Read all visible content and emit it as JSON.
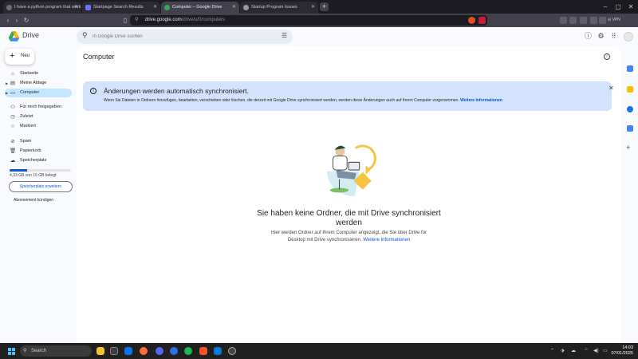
{
  "browser": {
    "tabs": [
      {
        "title": "I have a python program that work",
        "active": false
      },
      {
        "title": "Startpage Search Results",
        "active": false
      },
      {
        "title": "Computer – Google Drive",
        "active": true
      },
      {
        "title": "Startup Program Issues",
        "active": false
      }
    ],
    "url_host": "drive.google.com",
    "url_path": "/drive/u/0/computers",
    "vpn_label": "VPN"
  },
  "drive": {
    "app_name": "Drive",
    "search_placeholder": "In Google Drive suchen",
    "new_button": "Neu",
    "nav": [
      {
        "label": "Startseite",
        "icon": "home-icon"
      },
      {
        "label": "Meine Ablage",
        "icon": "my-drive-icon"
      },
      {
        "label": "Computer",
        "icon": "computer-icon",
        "active": true
      },
      {
        "label": "Für mich freigegeben",
        "icon": "shared-icon"
      },
      {
        "label": "Zuletzt",
        "icon": "clock-icon"
      },
      {
        "label": "Markiert",
        "icon": "star-icon"
      },
      {
        "label": "Spam",
        "icon": "spam-icon"
      },
      {
        "label": "Papierkorb",
        "icon": "trash-icon"
      },
      {
        "label": "Speicherplatz",
        "icon": "cloud-icon"
      }
    ],
    "storage": {
      "text": "4,33 GB von 15 GB belegt",
      "used_fraction": 0.29,
      "upgrade_button": "Speicherplatz erweitern",
      "cancel_link": "Abonnement kündigen"
    },
    "page_title": "Computer",
    "banner": {
      "title": "Änderungen werden automatisch synchronisiert.",
      "body": "Wenn Sie Dateien in Ordnern hinzufügen, bearbeiten, verschieben oder löschen, die derzeit mit Google Drive synchronisiert werden, werden diese Änderungen auch auf Ihrem Computer vorgenommen.",
      "link": "Weitere Informationen"
    },
    "empty_state": {
      "title_line1": "Sie haben keine Ordner, die mit Drive synchronisiert",
      "title_line2": "werden",
      "body_line1": "Hier werden Ordner auf Ihrem Computer angezeigt, die Sie über Drive for",
      "body_line2": "Desktop mit Drive synchronisieren.",
      "link": "Weitere Informationen"
    }
  },
  "taskbar": {
    "search_placeholder": "Search",
    "time": "14:03",
    "date": "07/01/2025"
  },
  "colors": {
    "accent": "#0b57d0",
    "active_nav": "#c2e7ff",
    "banner_bg": "#d3e3fd"
  }
}
